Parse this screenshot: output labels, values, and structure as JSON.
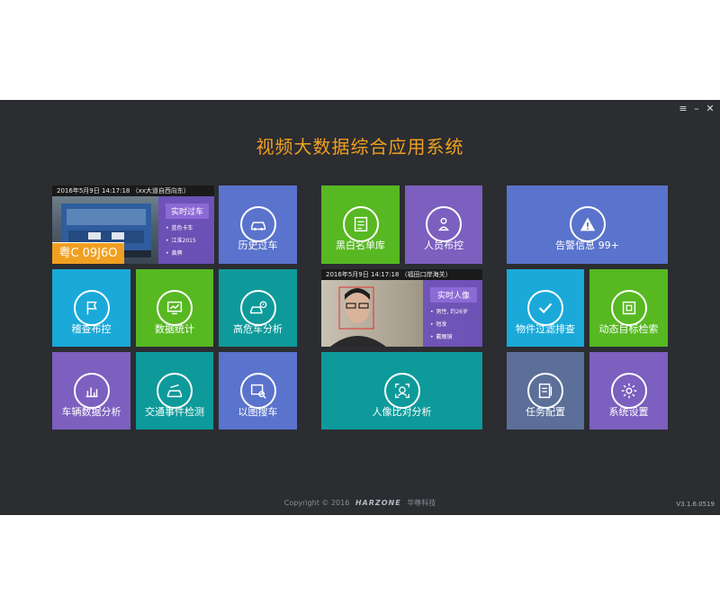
{
  "window": {
    "controls": [
      "≡",
      "–",
      "✕"
    ]
  },
  "app_title": "视频大数据综合应用系统",
  "tiles": {
    "history_pass": "历史过车",
    "blackwhite_list": "黑白名单库",
    "person_control": "人员布控",
    "alarm_info": "告警信息 99+",
    "check_control": "稽查布控",
    "data_stats": "数据统计",
    "danger_vehicle": "高危车分析",
    "object_filter": "物件过滤排查",
    "dynamic_target": "动态目标检索",
    "vehicle_data": "车辆数据分析",
    "traffic_event": "交通事件检测",
    "image_search": "以图搜车",
    "face_compare": "人像比对分析",
    "task_config": "任务配置",
    "system_settings": "系统设置"
  },
  "vehicle_cam": {
    "timestamp": "2016年5月9日  14:17:18  （xx大道自西向东）",
    "panel_title": "实时过车",
    "details": [
      "蓝色卡车",
      "江淮2015",
      "黄牌"
    ],
    "plate": "粤C 09J6O"
  },
  "face_cam": {
    "timestamp": "2016年5月9日  14:17:18  （福田口岸海关）",
    "panel_title": "实时人像",
    "details": [
      "男性, 约26岁",
      "短发",
      "戴眼镜"
    ]
  },
  "footer": {
    "copyright": "Copyright © 2016",
    "brand": "HARZONE",
    "company": "华尊科技",
    "version": "V3.1.6.0519"
  },
  "colors": {
    "background": "#2b2d31",
    "title": "#f0a020",
    "blue": "#5a73cc",
    "purple": "#7c5fbf",
    "cyan": "#1aa9d9",
    "green": "#57b822",
    "teal": "#0e9a9a",
    "slate": "#5c6f99"
  }
}
